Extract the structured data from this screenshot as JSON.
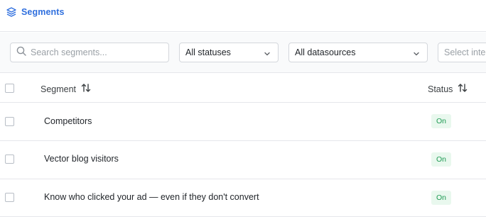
{
  "header": {
    "title": "Segments",
    "icon": "layers-icon",
    "accent": "#2f6fde"
  },
  "filters": {
    "search_placeholder": "Search segments...",
    "status_value": "All statuses",
    "datasource_value": "All datasources",
    "integration_placeholder": "Select integ"
  },
  "table": {
    "columns": [
      "Segment",
      "Status"
    ],
    "rows": [
      {
        "name": "Competitors",
        "status": "On"
      },
      {
        "name": "Vector blog visitors",
        "status": "On"
      },
      {
        "name": "Know who clicked your ad — even if they don't convert",
        "status": "On"
      }
    ]
  },
  "colors": {
    "status_on_bg": "#e9f8ee",
    "status_on_text": "#1e9a53"
  }
}
